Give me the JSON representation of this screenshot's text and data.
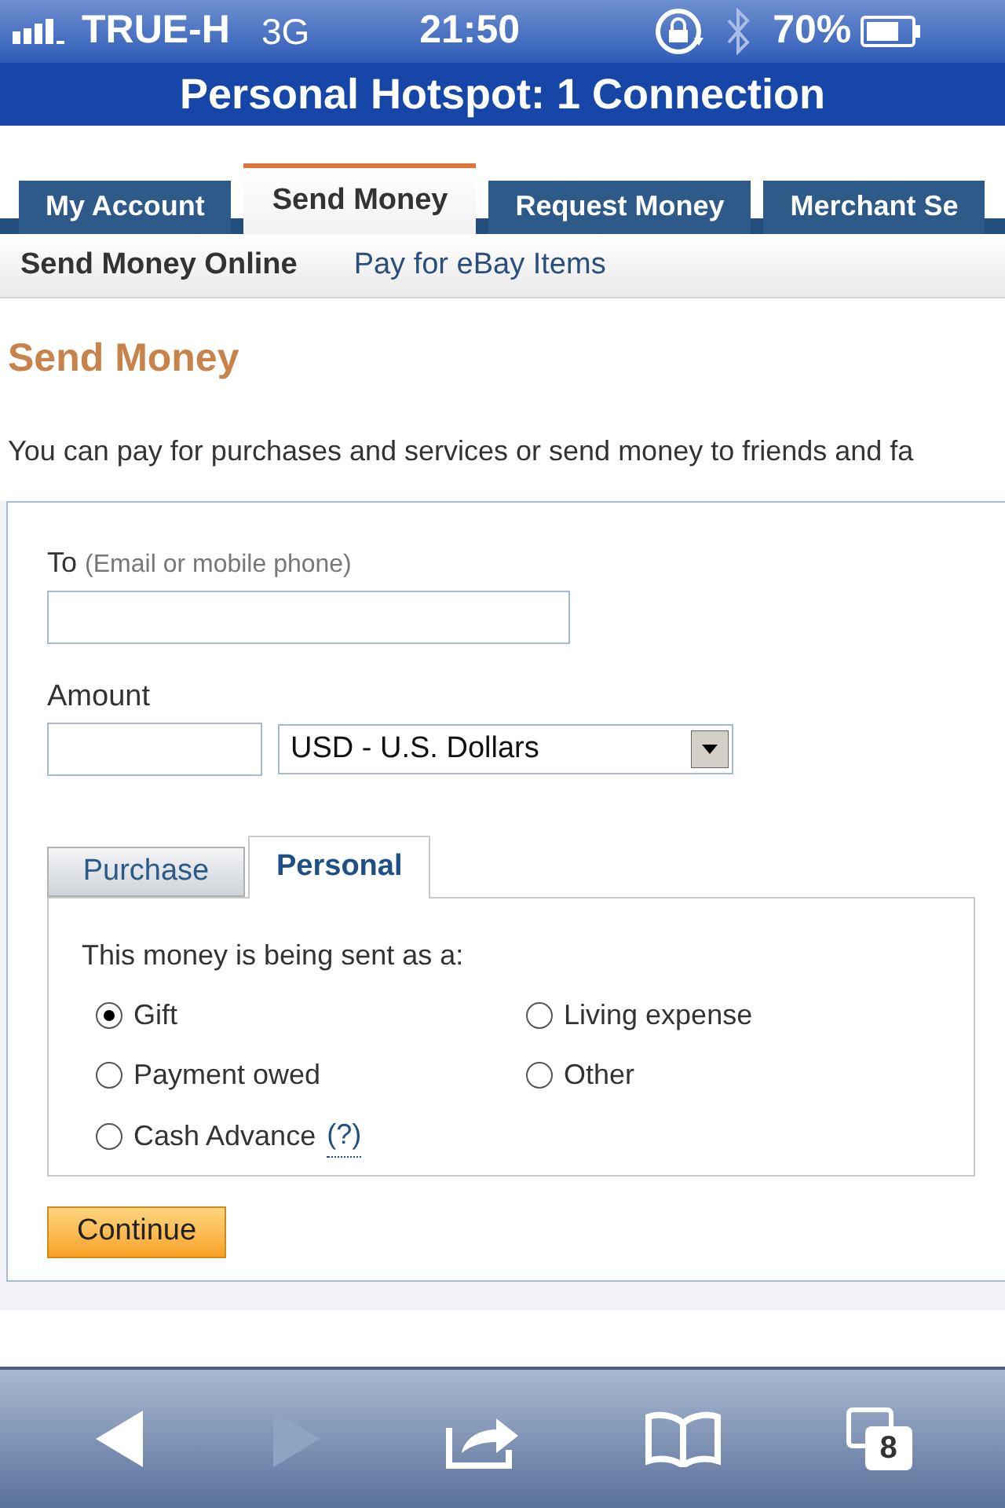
{
  "status_bar": {
    "carrier": "TRUE-H",
    "network": "3G",
    "time": "21:50",
    "battery": "70%"
  },
  "hotspot_banner": "Personal Hotspot: 1 Connection",
  "main_tabs": [
    {
      "label": "My Account",
      "selected": false
    },
    {
      "label": "Send Money",
      "selected": true
    },
    {
      "label": "Request Money",
      "selected": false
    },
    {
      "label": "Merchant Se",
      "selected": false
    }
  ],
  "sub_nav": [
    {
      "label": "Send Money Online",
      "selected": true
    },
    {
      "label": "Pay for eBay Items",
      "selected": false
    }
  ],
  "heading": "Send Money",
  "intro": "You can pay for purchases and services or send money to friends and fa",
  "form": {
    "to_label": "To",
    "to_hint": "(Email or mobile phone)",
    "amount_label": "Amount",
    "currency": "USD - U.S. Dollars",
    "payment_tabs": [
      {
        "label": "Purchase",
        "selected": false
      },
      {
        "label": "Personal",
        "selected": true
      }
    ],
    "question": "This money is being sent as a:",
    "options": [
      {
        "label": "Gift",
        "selected": true
      },
      {
        "label": "Living expense",
        "selected": false
      },
      {
        "label": "Payment owed",
        "selected": false
      },
      {
        "label": "Other",
        "selected": false
      },
      {
        "label": "Cash Advance",
        "help": "(?)",
        "selected": false
      }
    ],
    "continue_button": "Continue"
  },
  "toolbar": {
    "back_enabled": true,
    "forward_enabled": false,
    "tab_count": "8"
  }
}
